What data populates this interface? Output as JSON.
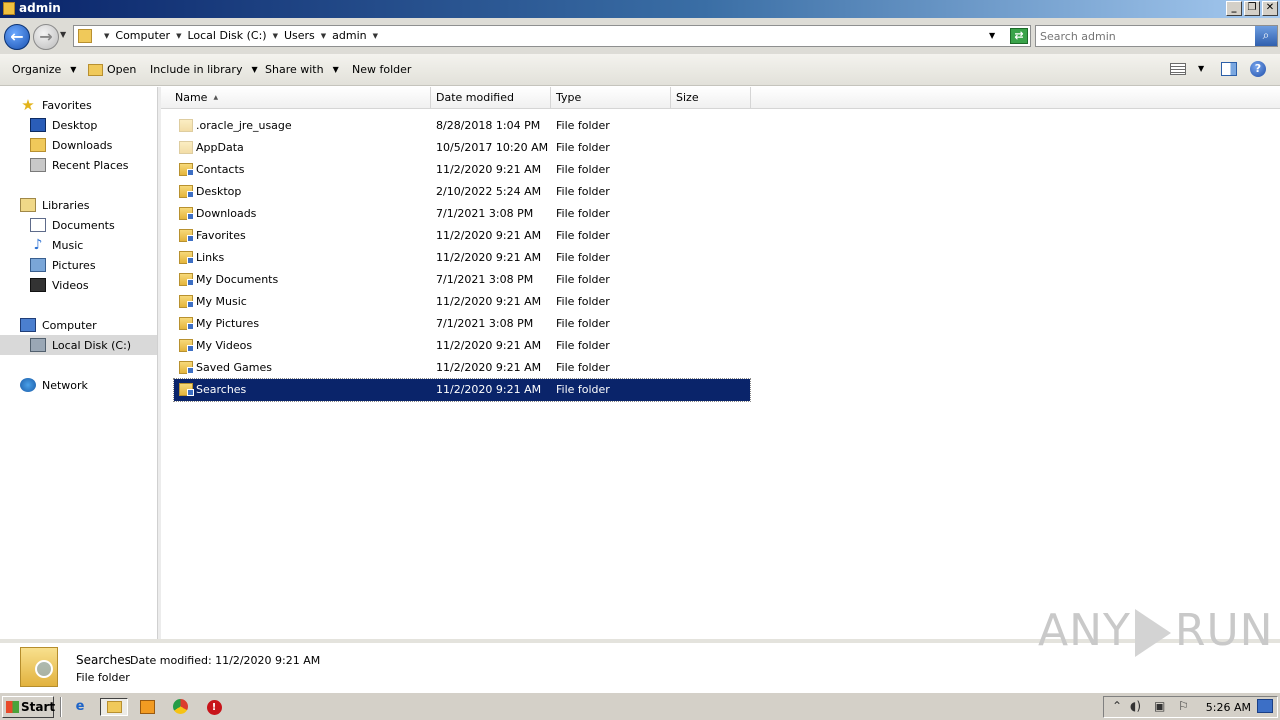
{
  "window": {
    "title": "admin",
    "min_glyph": "_",
    "max_glyph": "❐",
    "close_glyph": "✕"
  },
  "address": {
    "crumbs": [
      "Computer",
      "Local Disk (C:)",
      "Users",
      "admin"
    ],
    "search_placeholder": "Search admin"
  },
  "toolbar": {
    "organize": "Organize",
    "open": "Open",
    "include": "Include in library",
    "share": "Share with",
    "new_folder": "New folder"
  },
  "nav": {
    "favorites": {
      "label": "Favorites",
      "items": [
        "Desktop",
        "Downloads",
        "Recent Places"
      ]
    },
    "libraries": {
      "label": "Libraries",
      "items": [
        "Documents",
        "Music",
        "Pictures",
        "Videos"
      ]
    },
    "computer": {
      "label": "Computer",
      "items": [
        "Local Disk (C:)"
      ]
    },
    "network": {
      "label": "Network"
    }
  },
  "columns": {
    "name": "Name",
    "date": "Date modified",
    "type": "Type",
    "size": "Size"
  },
  "files": [
    {
      "name": ".oracle_jre_usage",
      "date": "8/28/2018 1:04 PM",
      "type": "File folder"
    },
    {
      "name": "AppData",
      "date": "10/5/2017 10:20 AM",
      "type": "File folder"
    },
    {
      "name": "Contacts",
      "date": "11/2/2020 9:21 AM",
      "type": "File folder"
    },
    {
      "name": "Desktop",
      "date": "2/10/2022 5:24 AM",
      "type": "File folder"
    },
    {
      "name": "Downloads",
      "date": "7/1/2021 3:08 PM",
      "type": "File folder"
    },
    {
      "name": "Favorites",
      "date": "11/2/2020 9:21 AM",
      "type": "File folder"
    },
    {
      "name": "Links",
      "date": "11/2/2020 9:21 AM",
      "type": "File folder"
    },
    {
      "name": "My Documents",
      "date": "7/1/2021 3:08 PM",
      "type": "File folder"
    },
    {
      "name": "My Music",
      "date": "11/2/2020 9:21 AM",
      "type": "File folder"
    },
    {
      "name": "My Pictures",
      "date": "7/1/2021 3:08 PM",
      "type": "File folder"
    },
    {
      "name": "My Videos",
      "date": "11/2/2020 9:21 AM",
      "type": "File folder"
    },
    {
      "name": "Saved Games",
      "date": "11/2/2020 9:21 AM",
      "type": "File folder"
    },
    {
      "name": "Searches",
      "date": "11/2/2020 9:21 AM",
      "type": "File folder"
    }
  ],
  "selected_file": "Searches",
  "details": {
    "name": "Searches",
    "modified": "Date modified: 11/2/2020 9:21 AM",
    "type": "File folder"
  },
  "watermark": {
    "left": "ANY",
    "right": "RUN"
  },
  "taskbar": {
    "start": "Start",
    "clock": "5:26 AM"
  },
  "colors": {
    "selection": "#0a246a",
    "title_start": "#0a246a",
    "title_end": "#a6caf0"
  }
}
